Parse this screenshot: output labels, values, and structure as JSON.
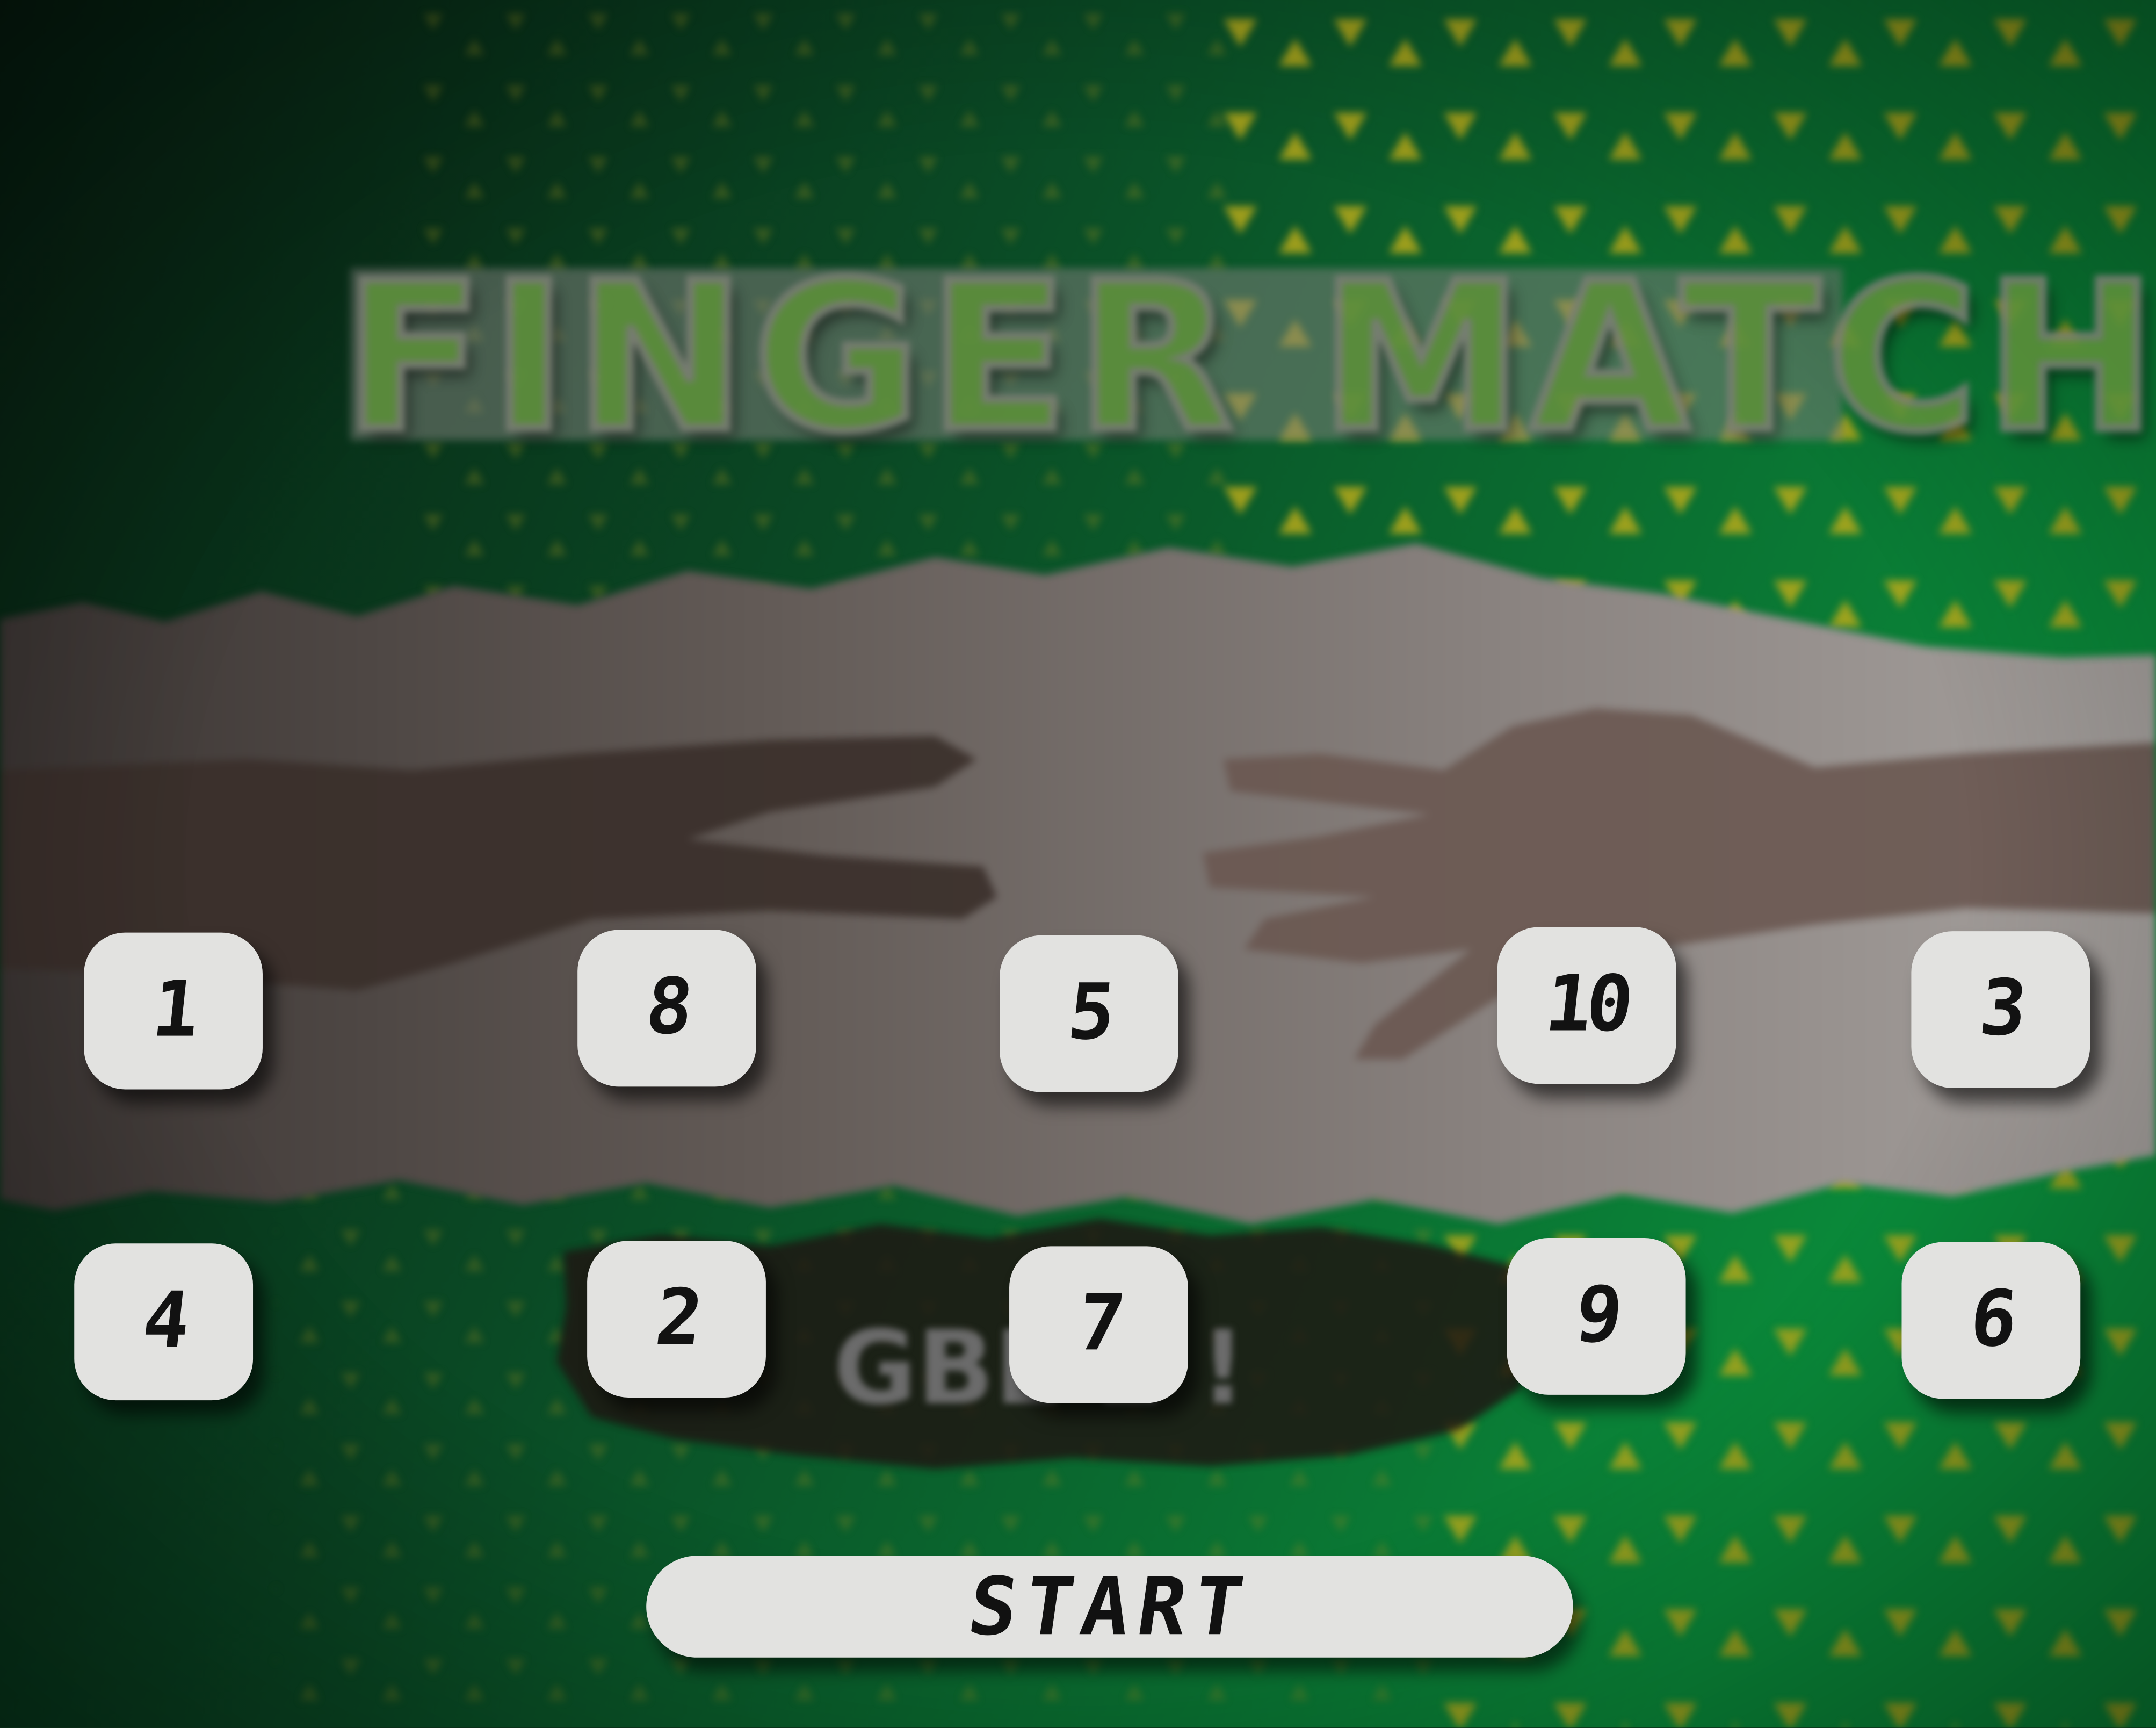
{
  "game": {
    "title": "FINGER MATCH",
    "background_banner": "GBL   E !",
    "start_label": "START"
  },
  "number_buttons": [
    {
      "label": "1"
    },
    {
      "label": "8"
    },
    {
      "label": "5"
    },
    {
      "label": "10"
    },
    {
      "label": "3"
    },
    {
      "label": "4"
    },
    {
      "label": "2"
    },
    {
      "label": "7"
    },
    {
      "label": "9"
    },
    {
      "label": "6"
    }
  ],
  "colors": {
    "background_dark": "#0b2a17",
    "background_green": "#0d7a35",
    "accent_yellow": "#c9b21e",
    "button_face": "#e2e2e0",
    "button_text": "#121212",
    "title_green": "#5c8f3a"
  }
}
